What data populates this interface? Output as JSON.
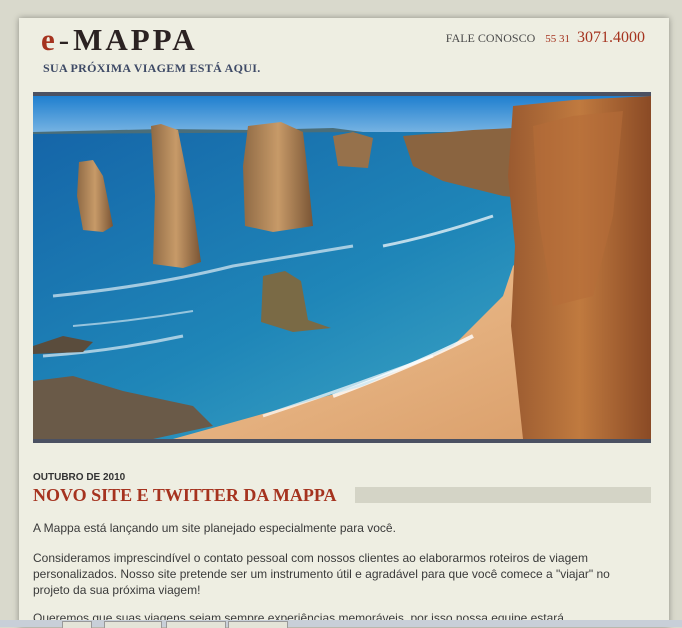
{
  "header": {
    "logo": {
      "e": "e",
      "dash": "-",
      "name": "MAPPA"
    },
    "tagline": "SUA PRÓXIMA VIAGEM ESTÁ AQUI.",
    "contact": {
      "label": "FALE CONOSCO",
      "ddd": "55 31",
      "number": "3071.4000"
    }
  },
  "post": {
    "date": "OUTUBRO DE 2010",
    "title": "NOVO SITE E TWITTER DA MAPPA",
    "paragraphs": [
      "A Mappa está lançando um site planejado especialmente para você.",
      "Consideramos imprescindível o contato pessoal com nossos clientes ao elaborarmos roteiros de viagem personalizados. Nosso site pretende ser um instrumento útil e agradável para que você comece a \"viajar\" no projeto da sua próxima viagem!",
      "Queremos que suas viagens sejam sempre experiências memoráveis, por isso nossa equipe estará"
    ]
  },
  "colors": {
    "accent": "#a5331f",
    "tagline": "#3e4a66",
    "page_bg": "#eeeee2",
    "hero_border": "#4b5162"
  },
  "hero_image": {
    "subject": "coastal-limestone-stacks-photo"
  }
}
